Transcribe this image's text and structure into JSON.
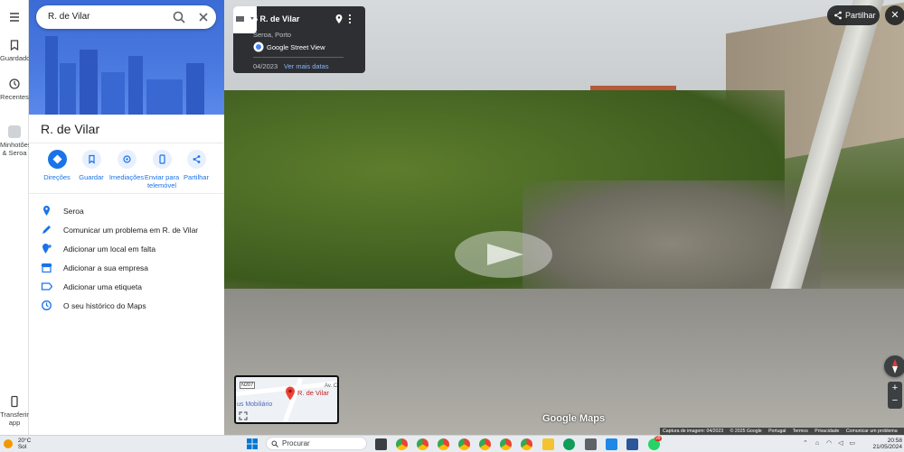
{
  "rail": {
    "menu_icon": "hamburger-icon",
    "items": [
      {
        "label": "Guardado",
        "icon": "bookmark-icon"
      },
      {
        "label": "Recentes",
        "icon": "history-icon"
      },
      {
        "label": "Minhotões & Seroa",
        "icon": "thumbnail"
      },
      {
        "label": "Transferir app",
        "icon": "phone-icon"
      }
    ]
  },
  "search": {
    "value": "R. de Vilar",
    "search_icon": "search-icon",
    "clear_icon": "close-icon"
  },
  "place": {
    "title": "R. de Vilar"
  },
  "actions": [
    {
      "label": "Direções",
      "icon": "directions-icon"
    },
    {
      "label": "Guardar",
      "icon": "bookmark-icon"
    },
    {
      "label": "Imediações",
      "icon": "nearby-icon"
    },
    {
      "label": "Enviar para telemóvel",
      "icon": "send-to-phone-icon"
    },
    {
      "label": "Partilhar",
      "icon": "share-icon"
    }
  ],
  "list": [
    {
      "label": "Seroa",
      "icon": "location-pin-icon"
    },
    {
      "label": "Comunicar um problema em R. de Vilar",
      "icon": "pencil-icon"
    },
    {
      "label": "Adicionar um local em falta",
      "icon": "add-place-icon"
    },
    {
      "label": "Adicionar a sua empresa",
      "icon": "store-icon"
    },
    {
      "label": "Adicionar uma etiqueta",
      "icon": "label-icon"
    },
    {
      "label": "O seu histórico do Maps",
      "icon": "history-icon"
    }
  ],
  "streetview": {
    "title": "5 R. de Vilar",
    "subtitle": "Seroa, Porto",
    "source": "Google Street View",
    "date": "04/2023",
    "more_dates": "Ver mais datas",
    "share": "Partilhar",
    "logo": "Google Maps",
    "minimap": {
      "road": "N207",
      "place": "R. de Vilar",
      "other": "us Mobiliário",
      "abbr": "Av. C"
    },
    "footer": [
      "Captura de imagem: 04/2023",
      "© 2025 Google",
      "Portugal",
      "Termos",
      "Privacidade",
      "Comunicar um problema"
    ]
  },
  "taskbar": {
    "temp": "20°C",
    "weather": "Sol",
    "search_placeholder": "Procurar",
    "time": "20:58",
    "date": "21/05/2024",
    "badge": "99"
  }
}
